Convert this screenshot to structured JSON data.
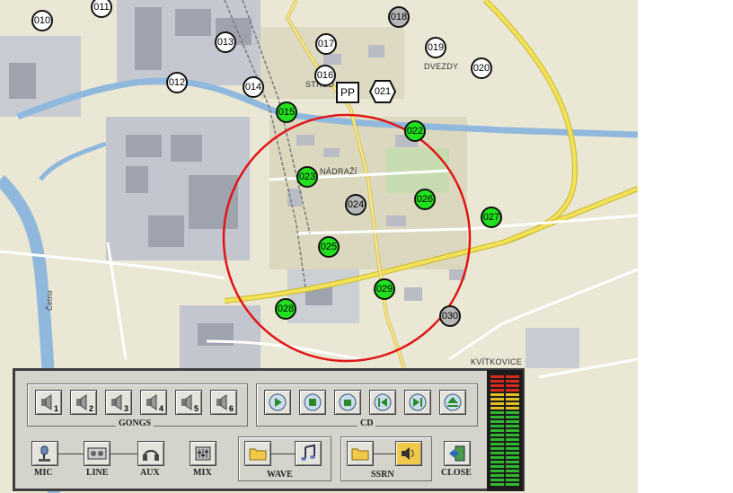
{
  "map": {
    "labels": {
      "stred": "STŘED",
      "nadrazi": "NÁDRAŽÍ",
      "dvezdy": "DVEZDY",
      "kvitkovice": "KVÍTKOVICE",
      "cetno": "Četno"
    },
    "markers": [
      {
        "id": "010",
        "color": "white"
      },
      {
        "id": "011",
        "color": "white"
      },
      {
        "id": "012",
        "color": "white"
      },
      {
        "id": "013",
        "color": "white"
      },
      {
        "id": "014",
        "color": "white"
      },
      {
        "id": "015",
        "color": "green"
      },
      {
        "id": "016",
        "color": "white"
      },
      {
        "id": "017",
        "color": "white"
      },
      {
        "id": "018",
        "color": "gray"
      },
      {
        "id": "019",
        "color": "white"
      },
      {
        "id": "020",
        "color": "white"
      },
      {
        "id": "022",
        "color": "green"
      },
      {
        "id": "023",
        "color": "green"
      },
      {
        "id": "024",
        "color": "gray"
      },
      {
        "id": "025",
        "color": "green"
      },
      {
        "id": "026",
        "color": "green"
      },
      {
        "id": "027",
        "color": "green"
      },
      {
        "id": "028",
        "color": "green"
      },
      {
        "id": "029",
        "color": "green"
      },
      {
        "id": "030",
        "color": "gray"
      }
    ],
    "pp_label": "PP",
    "hex_label": "021",
    "colors": {
      "green": "#22e01e",
      "gray": "#b7b7b7",
      "white": "#ffffff",
      "circle": "#e01515"
    }
  },
  "panel": {
    "gongs": {
      "label": "GONGS",
      "buttons": [
        {
          "icon": "speaker-icon",
          "num": "1"
        },
        {
          "icon": "speaker-icon",
          "num": "2"
        },
        {
          "icon": "speaker-icon",
          "num": "3"
        },
        {
          "icon": "speaker-icon",
          "num": "4"
        },
        {
          "icon": "speaker-icon",
          "num": "5"
        },
        {
          "icon": "speaker-icon",
          "num": "6"
        }
      ]
    },
    "cd": {
      "label": "CD",
      "buttons": [
        {
          "icon": "play-icon"
        },
        {
          "icon": "stop-icon"
        },
        {
          "icon": "pause-icon"
        },
        {
          "icon": "previous-track-icon"
        },
        {
          "icon": "next-track-icon"
        },
        {
          "icon": "eject-icon"
        }
      ]
    },
    "mic": {
      "label": "MIC",
      "icon": "microphone-icon"
    },
    "line": {
      "label": "LINE",
      "icon": "tape-deck-icon"
    },
    "aux": {
      "label": "AUX",
      "icon": "headphones-icon"
    },
    "mix": {
      "label": "MIX",
      "icon": "mixer-icon"
    },
    "wave": {
      "label": "WAVE",
      "icons": [
        "folder-icon",
        "music-notes-icon"
      ]
    },
    "ssrn": {
      "label": "SSRN",
      "icons": [
        "folder-icon",
        "volume-icon"
      ]
    },
    "close": {
      "label": "CLOSE",
      "icon": "exit-door-icon"
    }
  },
  "vu_meter": {
    "left_level": 1.0,
    "right_level": 1.0
  }
}
